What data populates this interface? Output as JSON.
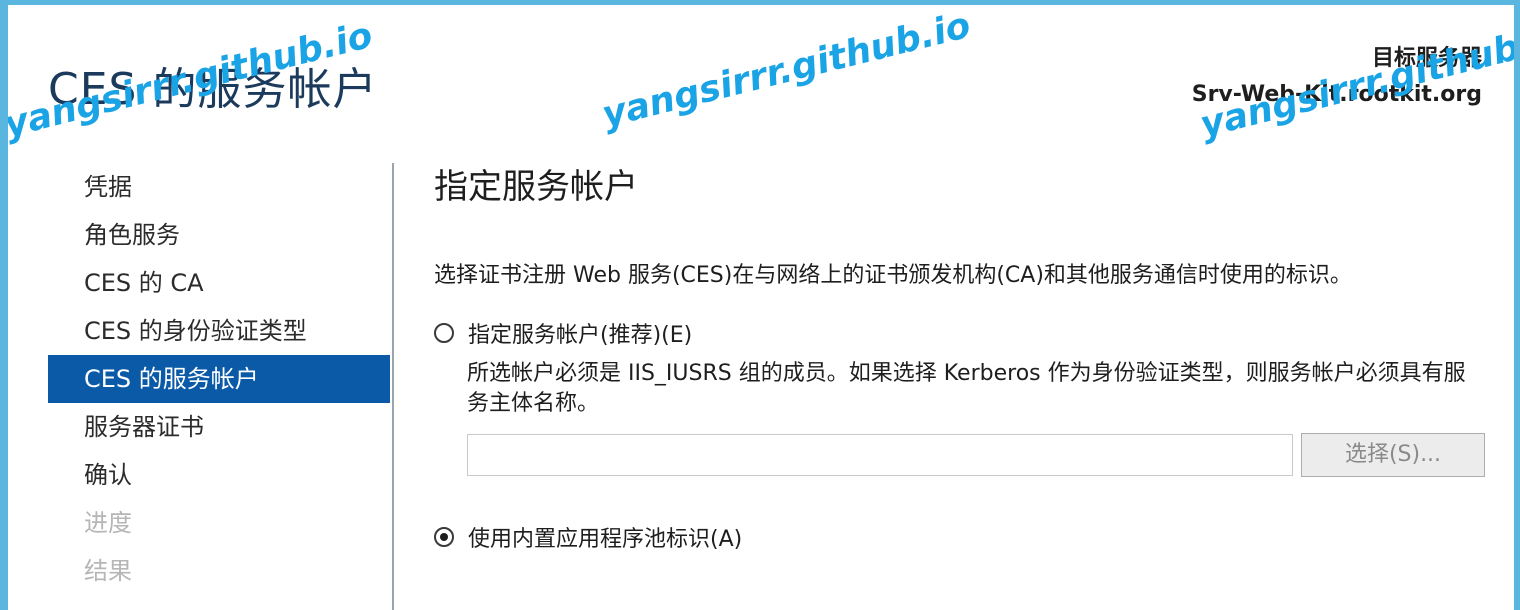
{
  "header": {
    "title": "CES 的服务帐户",
    "target_server_label": "目标服务器",
    "target_server_name": "Srv-Web-Kit.rootkit.org"
  },
  "nav": {
    "items": [
      {
        "label": "凭据",
        "state": "normal"
      },
      {
        "label": "角色服务",
        "state": "normal"
      },
      {
        "label": "CES 的 CA",
        "state": "normal"
      },
      {
        "label": "CES 的身份验证类型",
        "state": "normal"
      },
      {
        "label": "CES 的服务帐户",
        "state": "active"
      },
      {
        "label": "服务器证书",
        "state": "normal"
      },
      {
        "label": "确认",
        "state": "normal"
      },
      {
        "label": "进度",
        "state": "disabled"
      },
      {
        "label": "结果",
        "state": "disabled"
      }
    ]
  },
  "main": {
    "section_title": "指定服务帐户",
    "description": "选择证书注册 Web 服务(CES)在与网络上的证书颁发机构(CA)和其他服务通信时使用的标识。",
    "option_service_account": {
      "label": "指定服务帐户(推荐)(E)",
      "selected": false,
      "note": "所选帐户必须是 IIS_IUSRS 组的成员。如果选择 Kerberos 作为身份验证类型，则服务帐户必须具有服务主体名称。",
      "account_value": "",
      "browse_label": "选择(S)..."
    },
    "option_app_pool": {
      "label": "使用内置应用程序池标识(A)",
      "selected": true
    }
  },
  "watermark": {
    "text": "yangsirrr.github.io"
  },
  "colors": {
    "accent": "#0b5aa8",
    "frame": "#5ab6de",
    "watermark": "#1aa4e6",
    "disabled_text": "#b6b6b6"
  }
}
